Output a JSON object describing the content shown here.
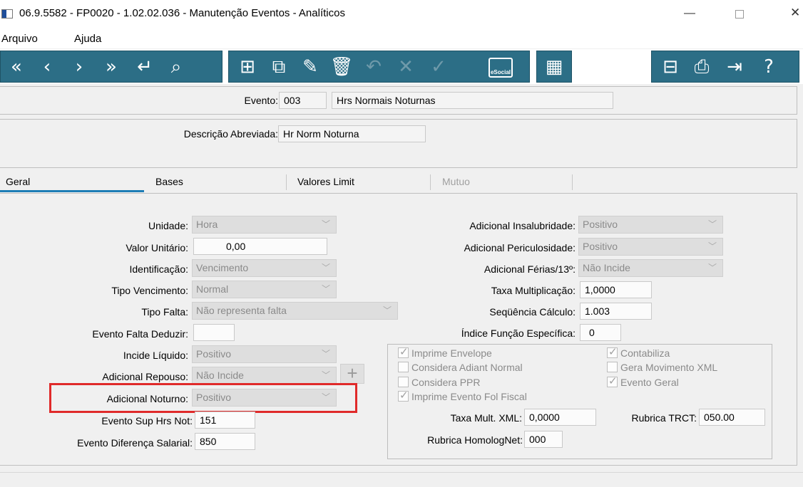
{
  "window": {
    "title": "06.9.5582 - FP0020 - 1.02.02.036 - Manutenção Eventos - Analíticos",
    "min_glyph": "—",
    "close_glyph": "✕"
  },
  "menu": {
    "file": "Arquivo",
    "help": "Ajuda"
  },
  "toolbar": {
    "accent": "#2c6e86",
    "esocial_label": "eSocial",
    "icons": [
      "first-icon",
      "prev-icon",
      "next-icon",
      "last-icon",
      "return-icon",
      "search-icon",
      "new-icon",
      "copy-icon",
      "edit-icon",
      "delete-icon",
      "undo-icon",
      "cancel-icon",
      "confirm-icon",
      "esocial-icon",
      "calendar-icon",
      "tree-icon",
      "print-icon",
      "exit-icon",
      "help-icon"
    ]
  },
  "header": {
    "evento_label": "Evento:",
    "evento_code": "003",
    "evento_name": "Hrs Normais Noturnas",
    "desc_label": "Descrição Abreviada:",
    "desc_value": "Hr Norm Noturna"
  },
  "tabs": [
    {
      "label": "Geral",
      "active": true
    },
    {
      "label": "Bases",
      "active": false
    },
    {
      "label": "Valores Limit",
      "active": false
    },
    {
      "label": "Mutuo",
      "active": false,
      "disabled": true
    }
  ],
  "left_fields": {
    "unidade": {
      "label": "Unidade:",
      "value": "Hora"
    },
    "valor_unitario": {
      "label": "Valor Unitário:",
      "value": "0,00"
    },
    "identificacao": {
      "label": "Identificação:",
      "value": "Vencimento"
    },
    "tipo_vencimento": {
      "label": "Tipo Vencimento:",
      "value": "Normal"
    },
    "tipo_falta": {
      "label": "Tipo Falta:",
      "value": "Não representa falta"
    },
    "evento_falta_deduzir": {
      "label": "Evento Falta Deduzir:",
      "value": ""
    },
    "incide_liquido": {
      "label": "Incide Líquido:",
      "value": "Positivo"
    },
    "adicional_repouso": {
      "label": "Adicional Repouso:",
      "value": "Não Incide"
    },
    "adicional_noturno": {
      "label": "Adicional Noturno:",
      "value": "Positivo"
    },
    "evento_sup_hrs_not": {
      "label": "Evento Sup Hrs Not:",
      "value": "151"
    },
    "evento_dif_salarial": {
      "label": "Evento Diferença Salarial:",
      "value": "850"
    }
  },
  "right_fields": {
    "adic_insalubridade": {
      "label": "Adicional Insalubridade:",
      "value": "Positivo"
    },
    "adic_periculosidade": {
      "label": "Adicional Periculosidade:",
      "value": "Positivo"
    },
    "adic_ferias": {
      "label": "Adicional Férias/13º:",
      "value": "Não Incide"
    },
    "taxa_multiplicacao": {
      "label": "Taxa Multiplicação:",
      "value": "1,0000"
    },
    "sequencia_calculo": {
      "label": "Seqüência Cálculo:",
      "value": "1.003"
    },
    "indice_funcao": {
      "label": "Índice Função Específica:",
      "value": "0"
    }
  },
  "checkboxes": [
    {
      "label": "Imprime Envelope",
      "checked": true
    },
    {
      "label": "Considera Adiant Normal",
      "checked": false
    },
    {
      "label": "Considera PPR",
      "checked": false
    },
    {
      "label": "Imprime Evento Fol Fiscal",
      "checked": true
    },
    {
      "label": "Contabiliza",
      "checked": true
    },
    {
      "label": "Gera Movimento XML",
      "checked": false
    },
    {
      "label": "Evento Geral",
      "checked": true
    }
  ],
  "group_fields": {
    "taxa_mult_xml": {
      "label": "Taxa Mult. XML:",
      "value": "0,0000"
    },
    "rubrica_trct": {
      "label": "Rubrica TRCT:",
      "value": "050.00"
    },
    "rubrica_homolognet": {
      "label": "Rubrica HomologNet:",
      "value": "000"
    }
  },
  "plus_glyph": "+",
  "highlight_color": "#e02a2a"
}
